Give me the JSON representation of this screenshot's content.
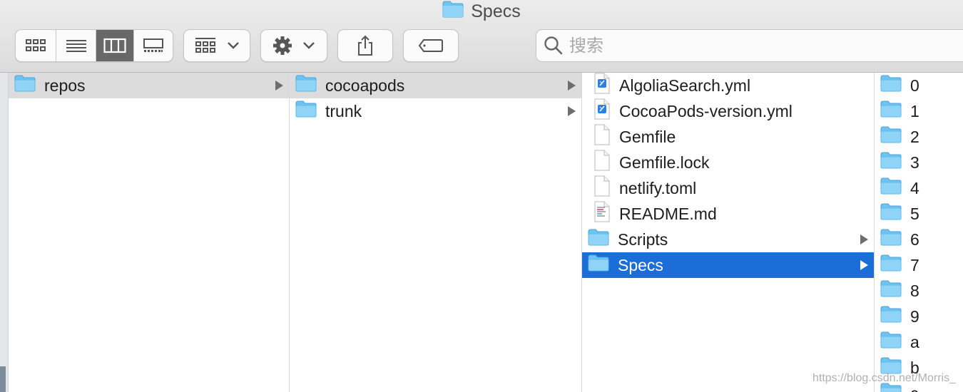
{
  "window": {
    "title": "Specs"
  },
  "toolbar": {
    "view_modes": [
      "icon-view",
      "list-view",
      "column-view",
      "gallery-view"
    ],
    "active_view": "column-view",
    "search_placeholder": "搜索"
  },
  "columns": [
    {
      "items": [
        {
          "name": "repos",
          "kind": "folder",
          "has_children": true,
          "selected": "gray"
        }
      ]
    },
    {
      "items": [
        {
          "name": "cocoapods",
          "kind": "folder",
          "has_children": true,
          "selected": "gray"
        },
        {
          "name": "trunk",
          "kind": "folder",
          "has_children": true,
          "selected": ""
        }
      ]
    },
    {
      "items": [
        {
          "name": "AlgoliaSearch.yml",
          "kind": "xcode-doc",
          "has_children": false,
          "selected": ""
        },
        {
          "name": "CocoaPods-version.yml",
          "kind": "xcode-doc",
          "has_children": false,
          "selected": ""
        },
        {
          "name": "Gemfile",
          "kind": "doc",
          "has_children": false,
          "selected": ""
        },
        {
          "name": "Gemfile.lock",
          "kind": "doc",
          "has_children": false,
          "selected": ""
        },
        {
          "name": "netlify.toml",
          "kind": "doc",
          "has_children": false,
          "selected": ""
        },
        {
          "name": "README.md",
          "kind": "text-doc",
          "has_children": false,
          "selected": ""
        },
        {
          "name": "Scripts",
          "kind": "folder",
          "has_children": true,
          "selected": ""
        },
        {
          "name": "Specs",
          "kind": "folder",
          "has_children": true,
          "selected": "blue"
        }
      ]
    },
    {
      "items": [
        {
          "name": "0",
          "kind": "folder",
          "has_children": false,
          "selected": ""
        },
        {
          "name": "1",
          "kind": "folder",
          "has_children": false,
          "selected": ""
        },
        {
          "name": "2",
          "kind": "folder",
          "has_children": false,
          "selected": ""
        },
        {
          "name": "3",
          "kind": "folder",
          "has_children": false,
          "selected": ""
        },
        {
          "name": "4",
          "kind": "folder",
          "has_children": false,
          "selected": ""
        },
        {
          "name": "5",
          "kind": "folder",
          "has_children": false,
          "selected": ""
        },
        {
          "name": "6",
          "kind": "folder",
          "has_children": false,
          "selected": ""
        },
        {
          "name": "7",
          "kind": "folder",
          "has_children": false,
          "selected": ""
        },
        {
          "name": "8",
          "kind": "folder",
          "has_children": false,
          "selected": ""
        },
        {
          "name": "9",
          "kind": "folder",
          "has_children": false,
          "selected": ""
        },
        {
          "name": "a",
          "kind": "folder",
          "has_children": false,
          "selected": ""
        },
        {
          "name": "b",
          "kind": "folder",
          "has_children": false,
          "selected": ""
        },
        {
          "name": "c",
          "kind": "folder",
          "has_children": false,
          "selected": ""
        }
      ]
    }
  ],
  "watermark": "https://blog.csdn.net/Morris_",
  "colors": {
    "selection_blue": "#1b6ed8",
    "selection_gray": "#dcdcdc",
    "folder_blue": "#6cc4f3"
  }
}
